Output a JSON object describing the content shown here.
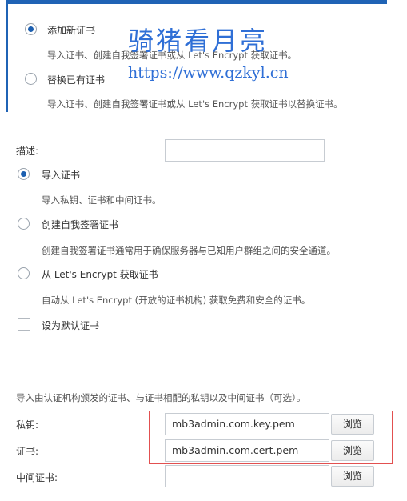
{
  "replace_section": {
    "option_add_new": {
      "label": "添加新证书",
      "desc": "导入证书、创建自我签署证书或从 Let's Encrypt 获取证书。"
    },
    "option_replace": {
      "label": "替换已有证书",
      "desc": "导入证书、创建自我签署证书或从 Let's Encrypt 获取证书以替换证书。"
    }
  },
  "watermark": {
    "title": "骑猪看月亮",
    "url": "https://www.qzkyl.cn"
  },
  "form": {
    "description_label": "描述:",
    "description_value": "",
    "options": [
      {
        "label": "导入证书",
        "desc": "导入私钥、证书和中间证书。",
        "checked": true
      },
      {
        "label": "创建自我签署证书",
        "desc": "创建自我签署证书通常用于确保服务器与已知用户群组之间的安全通道。",
        "checked": false
      },
      {
        "label": "从 Let's Encrypt 获取证书",
        "desc": "自动从 Let's Encrypt (开放的证书机构) 获取免费和安全的证书。",
        "checked": false
      }
    ],
    "default_checkbox_label": "设为默认证书"
  },
  "import": {
    "intro": "导入由认证机构颁发的证书、与证书相配的私钥以及中间证书（可选）。",
    "fields": [
      {
        "label": "私钥:",
        "value": "mb3admin.com.key.pem",
        "button": "浏览"
      },
      {
        "label": "证书:",
        "value": "mb3admin.com.cert.pem",
        "button": "浏览"
      },
      {
        "label": "中间证书:",
        "value": "",
        "button": "浏览"
      }
    ]
  },
  "colors": {
    "accent": "#1f63b5",
    "highlight_box": "#e25050",
    "watermark": "#2f6fd6"
  }
}
